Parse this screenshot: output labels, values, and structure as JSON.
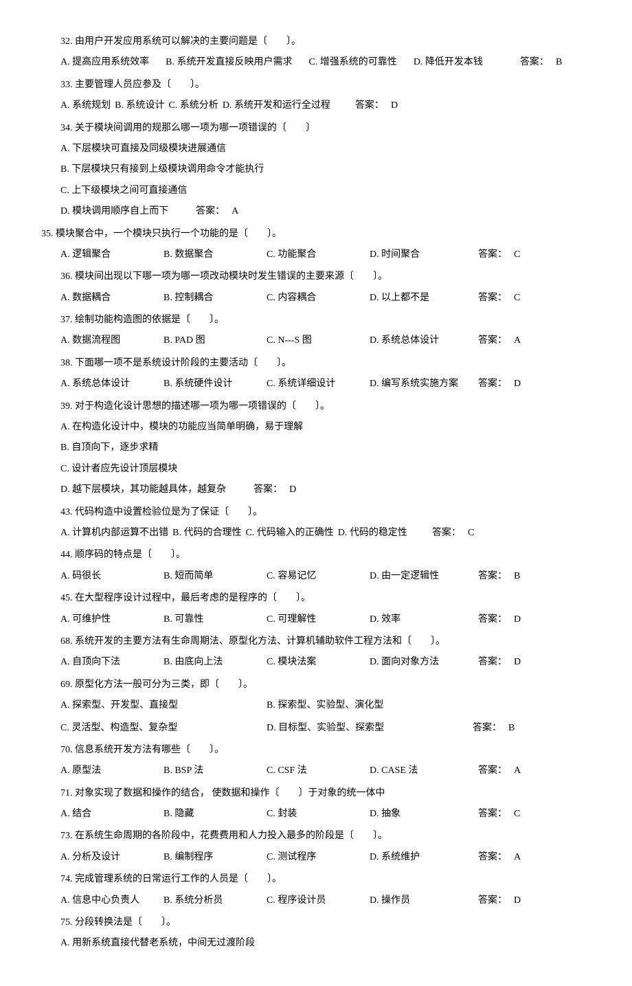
{
  "questions": [
    {
      "num": "32.",
      "stem": "由用户开发应用系统可以解决的主要问题是〔　　〕。",
      "opts": [
        [
          "A.",
          "提高应用系统效率"
        ],
        [
          "B.",
          "系统开发直接反映用户需求"
        ],
        [
          "C.",
          "增强系统的可靠性"
        ],
        [
          "D.",
          "降低开发本钱"
        ]
      ],
      "ans_label": "答案：",
      "ans": "B",
      "layout": "inline"
    },
    {
      "num": "33.",
      "stem": "主要管理人员应参及〔　　〕。",
      "opts": [
        [
          "A.",
          "系统规划"
        ],
        [
          "B.",
          "系统设计"
        ],
        [
          "C.",
          "系统分析"
        ],
        [
          "D.",
          "系统开发和运行全过程"
        ]
      ],
      "ans_label": "答案：",
      "ans": "D",
      "layout": "inline-compact"
    },
    {
      "num": "34.",
      "stem": "关于模块间调用的规那么哪一项为哪一项错误的〔　　〕",
      "opts": [
        [
          "A.",
          "下层模块可直接及同级模块进展通信"
        ],
        [
          "B.",
          "下层模块只有接到上级模块调用命令才能执行"
        ],
        [
          "C.",
          "上下级模块之间可直接通信"
        ],
        [
          "D.",
          "模块调用顺序自上而下"
        ]
      ],
      "ans_label": "答案：",
      "ans": "A",
      "layout": "block"
    },
    {
      "num": "35.",
      "noindent": true,
      "stem": "模块聚合中，一个模块只执行一个功能的是〔　　〕。",
      "opts": [
        [
          "A.",
          "逻辑聚合"
        ],
        [
          "B.",
          "数据聚合"
        ],
        [
          "C.",
          "功能聚合"
        ],
        [
          "D.",
          "时间聚合"
        ]
      ],
      "ans_label": "答案：",
      "ans": "C",
      "layout": "four-col"
    },
    {
      "num": "36.",
      "stem": "模块间出现以下哪一项为哪一项改动模块时发生错误的主要来源〔　　〕。",
      "opts": [
        [
          "A.",
          "数据耦合"
        ],
        [
          "B.",
          "控制耦合"
        ],
        [
          "C.",
          "内容耦合"
        ],
        [
          "D.",
          "以上都不是"
        ]
      ],
      "ans_label": "答案：",
      "ans": "C",
      "layout": "four-col"
    },
    {
      "num": "37.",
      "stem": "绘制功能构造图的依据是〔　　〕。",
      "opts": [
        [
          "A.",
          "数据流程图"
        ],
        [
          "B.",
          "PAD 图"
        ],
        [
          "C.",
          "N---S 图"
        ],
        [
          "D.",
          "系统总体设计"
        ]
      ],
      "ans_label": "答案：",
      "ans": "A",
      "layout": "four-col"
    },
    {
      "num": "38.",
      "stem": "下面哪一项不是系统设计阶段的主要活动〔　　〕。",
      "opts": [
        [
          "A.",
          "系统总体设计"
        ],
        [
          "B.",
          "系统硬件设计"
        ],
        [
          "C.",
          "系统详细设计"
        ],
        [
          "D.",
          "编写系统实施方案"
        ]
      ],
      "ans_label": "答案：",
      "ans": "D",
      "layout": "four-col"
    },
    {
      "num": "39.",
      "stem": "对于构造化设计思想的描述哪一项为哪一项错误的〔　　〕。",
      "opts": [
        [
          "A.",
          "在构造化设计中，模块的功能应当简单明确，易于理解"
        ],
        [
          "B.",
          "自顶向下，逐步求精"
        ],
        [
          "C.",
          "设计者应先设计顶层模块"
        ],
        [
          "D.",
          "越下层模块，其功能越具体，越复杂"
        ]
      ],
      "ans_label": "答案：",
      "ans": "D",
      "layout": "block"
    },
    {
      "num": "43.",
      "stem": "代码构造中设置检验位是为了保证〔　　〕。",
      "opts": [
        [
          "A.",
          "计算机内部运算不出错"
        ],
        [
          "B.",
          "代码的合理性"
        ],
        [
          "C.",
          "代码输入的正确性"
        ],
        [
          "D.",
          "代码的稳定性"
        ]
      ],
      "ans_label": "答案：",
      "ans": "C",
      "layout": "inline-compact"
    },
    {
      "num": "44.",
      "stem": "顺序码的特点是〔　　〕。",
      "opts": [
        [
          "A.",
          "码很长"
        ],
        [
          "B.",
          "短而简单"
        ],
        [
          "C.",
          "容易记忆"
        ],
        [
          "D.",
          "由一定逻辑性"
        ]
      ],
      "ans_label": "答案：",
      "ans": "B",
      "layout": "four-col"
    },
    {
      "num": "45.",
      "stem": "在大型程序设计过程中，最后考虑的是程序的〔　　〕。",
      "opts": [
        [
          "A.",
          "可维护性"
        ],
        [
          "B.",
          "可靠性"
        ],
        [
          "C.",
          "可理解性"
        ],
        [
          "D.",
          "效率"
        ]
      ],
      "ans_label": "答案：",
      "ans": "D",
      "layout": "four-col"
    },
    {
      "num": "68.",
      "stem": "系统开发的主要方法有生命周期法、原型化方法、计算机辅助软件工程方法和〔　　〕。",
      "opts": [
        [
          "A.",
          "自顶向下法"
        ],
        [
          "B.",
          "由底向上法"
        ],
        [
          "C.",
          "模块法案"
        ],
        [
          "D.",
          "面向对象方法"
        ]
      ],
      "ans_label": "答案：",
      "ans": "D",
      "layout": "four-col"
    },
    {
      "num": "69.",
      "stem": "原型化方法一般可分为三类，即〔　　〕。",
      "opts": [
        [
          "A.",
          "探索型、开发型、直接型"
        ],
        [
          "B.",
          "探索型、实验型、演化型"
        ],
        [
          "C.",
          "灵活型、构造型、复杂型"
        ],
        [
          "D.",
          "目标型、实验型、探索型"
        ]
      ],
      "ans_label": "答案：",
      "ans": "B",
      "layout": "two-col"
    },
    {
      "num": "70.",
      "stem": "信息系统开发方法有哪些〔　　〕。",
      "opts": [
        [
          "A.",
          "原型法"
        ],
        [
          "B.",
          "BSP 法"
        ],
        [
          "C.",
          "CSF 法"
        ],
        [
          "D.",
          "CASE 法"
        ]
      ],
      "ans_label": "答案：",
      "ans": "A",
      "layout": "four-col"
    },
    {
      "num": "71.",
      "stem": "对象实现了数据和操作的结合， 使数据和操作〔　　〕于对象的统一体中",
      "opts": [
        [
          "A.",
          "结合"
        ],
        [
          "B.",
          "隐藏"
        ],
        [
          "C.",
          "封装"
        ],
        [
          "D.",
          "抽象"
        ]
      ],
      "ans_label": "答案：",
      "ans": "C",
      "layout": "four-col"
    },
    {
      "num": "73.",
      "stem": "在系统生命周期的各阶段中，花费费用和人力投入最多的阶段是〔　　〕。",
      "opts": [
        [
          "A.",
          "分析及设计"
        ],
        [
          "B.",
          "编制程序"
        ],
        [
          "C.",
          "测试程序"
        ],
        [
          "D.",
          "系统维护"
        ]
      ],
      "ans_label": "答案：",
      "ans": "A",
      "layout": "four-col"
    },
    {
      "num": "74.",
      "stem": "完成管理系统的日常运行工作的人员是〔　　〕。",
      "opts": [
        [
          "A.",
          "信息中心负责人"
        ],
        [
          "B.",
          "系统分析员"
        ],
        [
          "C.",
          "程序设计员"
        ],
        [
          "D.",
          "操作员"
        ]
      ],
      "ans_label": "答案：",
      "ans": "D",
      "layout": "four-col"
    },
    {
      "num": "75.",
      "stem": "分段转换法是〔　　〕。",
      "opts": [
        [
          "A.",
          "用新系统直接代替老系统，中间无过渡阶段"
        ]
      ],
      "ans_label": "",
      "ans": "",
      "layout": "partial"
    }
  ]
}
